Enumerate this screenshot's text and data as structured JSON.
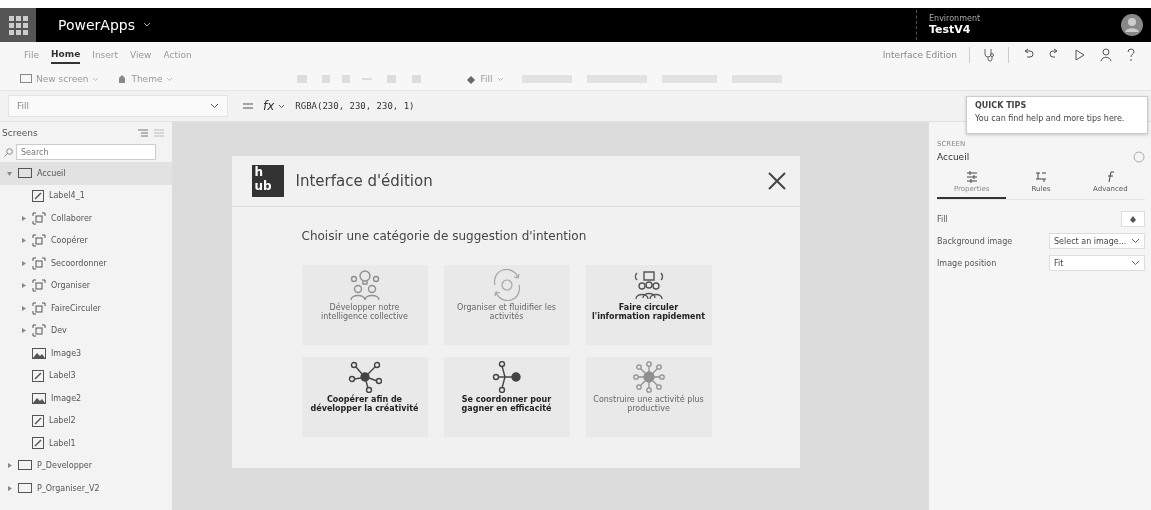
{
  "app_bar": {
    "title": "PowerApps",
    "environment_label": "Environment",
    "environment": "TestV4"
  },
  "menu": [
    {
      "label": "File",
      "selected": false
    },
    {
      "label": "Home",
      "selected": true
    },
    {
      "label": "Insert",
      "selected": false
    },
    {
      "label": "View",
      "selected": false
    },
    {
      "label": "Action",
      "selected": false
    }
  ],
  "app_name": "Interface Edition",
  "toolbar": {
    "new_screen": "New screen",
    "theme": "Theme",
    "fill": "Fill"
  },
  "formula_bar": {
    "property": "Fill",
    "fx": "fx",
    "formula": "RGBA(230, 230, 230, 1)"
  },
  "quick_tips": {
    "title": "QUICK TIPS",
    "text": "You can find help and more tips here."
  },
  "tree": {
    "title": "Screens",
    "search": {
      "placeholder": "Search"
    },
    "items": [
      {
        "kind": "screen",
        "label": "Accueil",
        "selected": true,
        "expanded": true,
        "children": [
          {
            "kind": "label",
            "label": "Label4_1"
          },
          {
            "kind": "group",
            "label": "Collaborer",
            "expanded": false
          },
          {
            "kind": "group",
            "label": "Coopérer",
            "expanded": false
          },
          {
            "kind": "group",
            "label": "Secoordonner",
            "expanded": false
          },
          {
            "kind": "group",
            "label": "Organiser",
            "expanded": false
          },
          {
            "kind": "group",
            "label": "FaireCirculer",
            "expanded": false
          },
          {
            "kind": "group",
            "label": "Dev",
            "expanded": false
          },
          {
            "kind": "image",
            "label": "Image3"
          },
          {
            "kind": "label",
            "label": "Label3"
          },
          {
            "kind": "image",
            "label": "Image2"
          },
          {
            "kind": "label",
            "label": "Label2"
          },
          {
            "kind": "label",
            "label": "Label1"
          }
        ]
      },
      {
        "kind": "screen",
        "label": "P_Developper",
        "selected": false,
        "expanded": false
      },
      {
        "kind": "screen",
        "label": "P_Organiser_V2",
        "selected": false,
        "expanded": false
      }
    ]
  },
  "dialog": {
    "logo_top": "h",
    "logo_bottom": "ub",
    "title": "Interface d'édition",
    "heading": "Choisir une catégorie de suggestion d'intention",
    "cards": [
      {
        "label": "Développer notre intelligence collective",
        "disabled": true
      },
      {
        "label": "Organiser et fluidifier les activités",
        "disabled": true
      },
      {
        "label": "Faire circuler l'information rapidement",
        "disabled": false
      },
      {
        "label": "Coopérer afin de développer la créativité",
        "disabled": false
      },
      {
        "label": "Se coordonner pour gagner en efficacité",
        "disabled": false
      },
      {
        "label": "Construire une activité plus productive",
        "disabled": true
      }
    ]
  },
  "properties": {
    "type": "SCREEN",
    "name": "Accueil",
    "tabs": [
      {
        "label": "Properties",
        "selected": true
      },
      {
        "label": "Rules",
        "selected": false
      },
      {
        "label": "Advanced",
        "selected": false
      }
    ],
    "rows": [
      {
        "kind": "color",
        "label": "Fill"
      },
      {
        "kind": "select",
        "label": "Background image",
        "value": "Select an image..."
      },
      {
        "kind": "select",
        "label": "Image position",
        "value": "Fit"
      }
    ]
  }
}
